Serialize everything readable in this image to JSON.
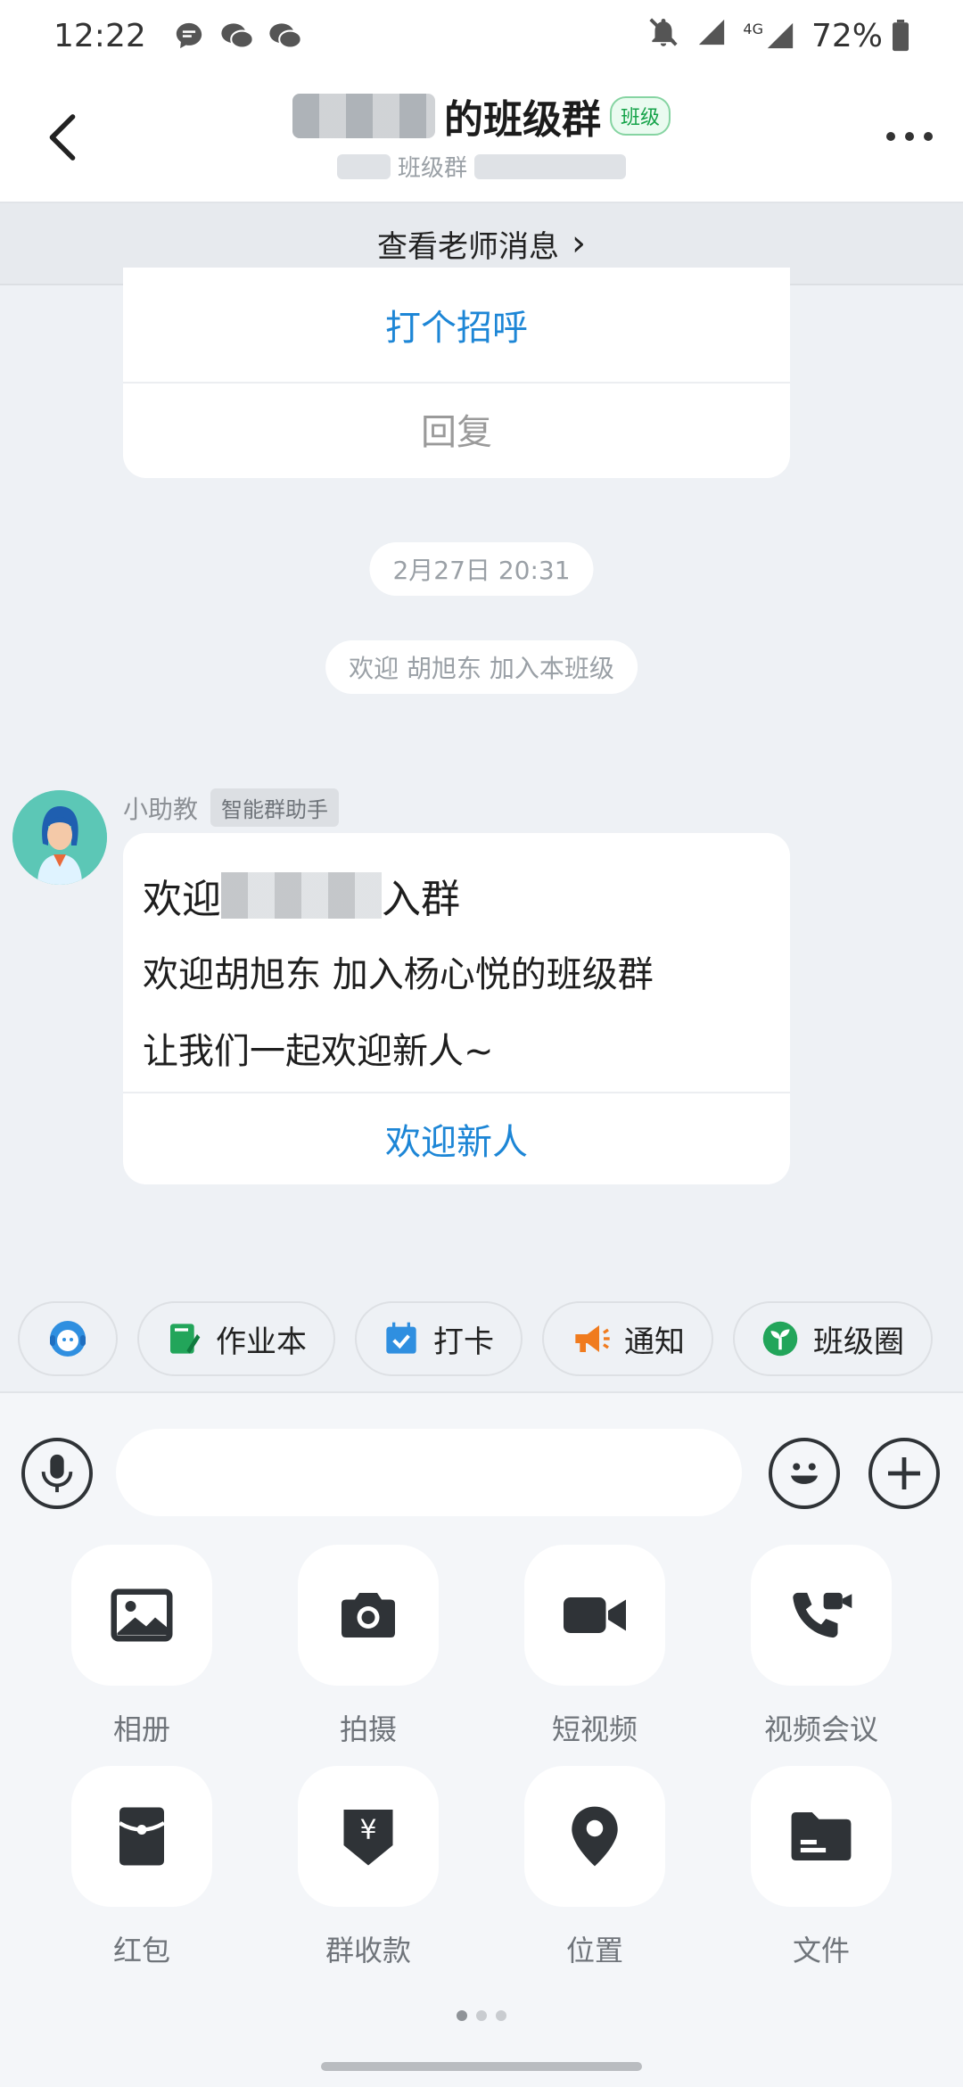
{
  "status_bar": {
    "time": "12:22",
    "battery": "72%",
    "network": "4G"
  },
  "header": {
    "title_suffix": "的班级群",
    "tag": "班级",
    "subtitle": "班级群"
  },
  "banner": {
    "text": "查看老师消息",
    "chevron": "›"
  },
  "card_top": {
    "greet": "打个招呼",
    "reply": "回复"
  },
  "timeline": {
    "timestamp": "2月27日 20:31",
    "welcome_notice": "欢迎 胡旭东 加入本班级"
  },
  "message": {
    "sender": "小助教",
    "sender_badge": "智能群助手",
    "line1_prefix": "欢迎",
    "line1_suffix": "入群",
    "line2": "欢迎胡旭东 加入杨心悦的班级群",
    "line3": "让我们一起欢迎新人~",
    "action": "欢迎新人"
  },
  "quick_tools": [
    "作业本",
    "打卡",
    "通知",
    "班级圈"
  ],
  "input": {
    "placeholder": ""
  },
  "grid": [
    "相册",
    "拍摄",
    "短视频",
    "视频会议",
    "红包",
    "群收款",
    "位置",
    "文件"
  ],
  "colors": {
    "accent_blue": "#1d86d6",
    "tag_green": "#16a34a",
    "background": "#eef1f5"
  }
}
